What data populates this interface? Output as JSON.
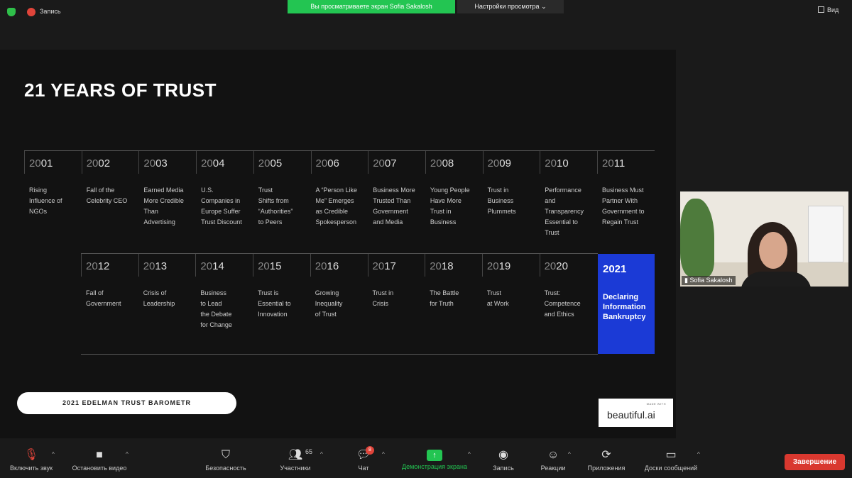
{
  "top_bar": {
    "recording_label": "Запись",
    "sharing_banner": "Вы просматриваете экран Sofia Sakalosh",
    "view_options_label": "Настройки просмотра",
    "view_button_label": "Вид",
    "colors": {
      "banner": "#23c552",
      "security": "#2fbf4a",
      "recording": "#e0443a"
    }
  },
  "slide": {
    "title": "21 YEARS OF TRUST",
    "row1": [
      {
        "year_dim": "20",
        "year": "01",
        "desc": "Rising\nInfluence of\nNGOs"
      },
      {
        "year_dim": "20",
        "year": "02",
        "desc": "Fall of the\nCelebrity CEO"
      },
      {
        "year_dim": "20",
        "year": "03",
        "desc": "Earned Media\nMore Credible\nThan\nAdvertising"
      },
      {
        "year_dim": "20",
        "year": "04",
        "desc": "U.S.\nCompanies in\nEurope Suffer\nTrust Discount"
      },
      {
        "year_dim": "20",
        "year": "05",
        "desc": "Trust\nShifts from\n“Authorities”\nto Peers"
      },
      {
        "year_dim": "20",
        "year": "06",
        "desc": "A “Person Like\nMe” Emerges\nas Credible\nSpokesperson"
      },
      {
        "year_dim": "20",
        "year": "07",
        "desc": "Business More\nTrusted Than\nGovernment\nand Media"
      },
      {
        "year_dim": "20",
        "year": "08",
        "desc": "Young People\nHave More\nTrust in\nBusiness"
      },
      {
        "year_dim": "20",
        "year": "09",
        "desc": "Trust in\nBusiness\nPlummets"
      },
      {
        "year_dim": "20",
        "year": "10",
        "desc": "Performance\nand\nTransparency\nEssential to\nTrust"
      },
      {
        "year_dim": "20",
        "year": "11",
        "desc": "Business Must\nPartner With\nGovernment to\nRegain Trust"
      }
    ],
    "row2": [
      {
        "year_dim": "20",
        "year": "12",
        "desc": "Fall of\nGovernment"
      },
      {
        "year_dim": "20",
        "year": "13",
        "desc": "Crisis of\nLeadership"
      },
      {
        "year_dim": "20",
        "year": "14",
        "desc": "Business\nto Lead\nthe Debate\nfor Change"
      },
      {
        "year_dim": "20",
        "year": "15",
        "desc": "Trust is\nEssential to\nInnovation"
      },
      {
        "year_dim": "20",
        "year": "16",
        "desc": "Growing\nInequality\nof Trust"
      },
      {
        "year_dim": "20",
        "year": "17",
        "desc": "Trust in\nCrisis"
      },
      {
        "year_dim": "20",
        "year": "18",
        "desc": "The Battle\nfor Truth"
      },
      {
        "year_dim": "20",
        "year": "19",
        "desc": "Trust\nat Work"
      },
      {
        "year_dim": "20",
        "year": "20",
        "desc": "Trust:\nCompetence\nand Ethics"
      }
    ],
    "highlight": {
      "year": "2021",
      "desc": "Declaring\nInformation\nBankruptcy",
      "color": "#1b3ad6"
    },
    "footer_pill": "2021 EDELMAN TRUST BAROMETR",
    "badge": {
      "made_with": "MADE WITH",
      "brand": "beautiful.ai"
    }
  },
  "video": {
    "participant_name": "Sofia Sakalosh"
  },
  "toolbar": {
    "mute": "Включить звук",
    "video": "Остановить видео",
    "security": "Безопасность",
    "participants": "Участники",
    "participants_count": "65",
    "chat": "Чат",
    "chat_badge": "8",
    "share": "Демонстрация экрана",
    "record": "Запись",
    "reactions": "Реакции",
    "apps": "Приложения",
    "whiteboards": "Доски сообщений",
    "end": "Завершение",
    "colors": {
      "end": "#d9382f",
      "share": "#23c552"
    }
  }
}
